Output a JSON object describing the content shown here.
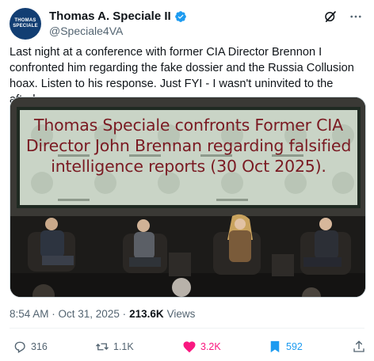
{
  "author": {
    "display_name": "Thomas A. Speciale II",
    "handle": "@Speciale4VA",
    "avatar_text_line1": "THOMAS",
    "avatar_text_line2": "SPECIALE",
    "verified": true
  },
  "tweet": {
    "text": "Last night at a conference with former CIA Director Brennon I confronted him regarding the fake dossier and the Russia Collusion hoax. Listen to his response. Just FYI - I wasn't uninvited to the afterhours.",
    "timestamp": "8:54 AM · Oct 31, 2025 ·",
    "views_count": "213.6K",
    "views_label": "Views"
  },
  "media": {
    "caption_line1": "Thomas Speciale confronts Former CIA",
    "caption_line2": "Director John Brennan regarding falsified",
    "caption_line3": "intelligence reports (30 Oct 2025)."
  },
  "actions": {
    "replies": "316",
    "reposts": "1.1K",
    "likes": "3.2K",
    "bookmarks": "592"
  },
  "icons": {
    "grok": "grok-icon",
    "more": "more-icon",
    "reply": "reply-icon",
    "repost": "repost-icon",
    "like": "heart-icon",
    "bookmark": "bookmark-icon",
    "share": "share-icon"
  },
  "colors": {
    "like": "#f91880",
    "bookmark": "#1d9bf0",
    "verified": "#1d9bf0",
    "muted": "#536471",
    "caption": "#7a1a22"
  }
}
